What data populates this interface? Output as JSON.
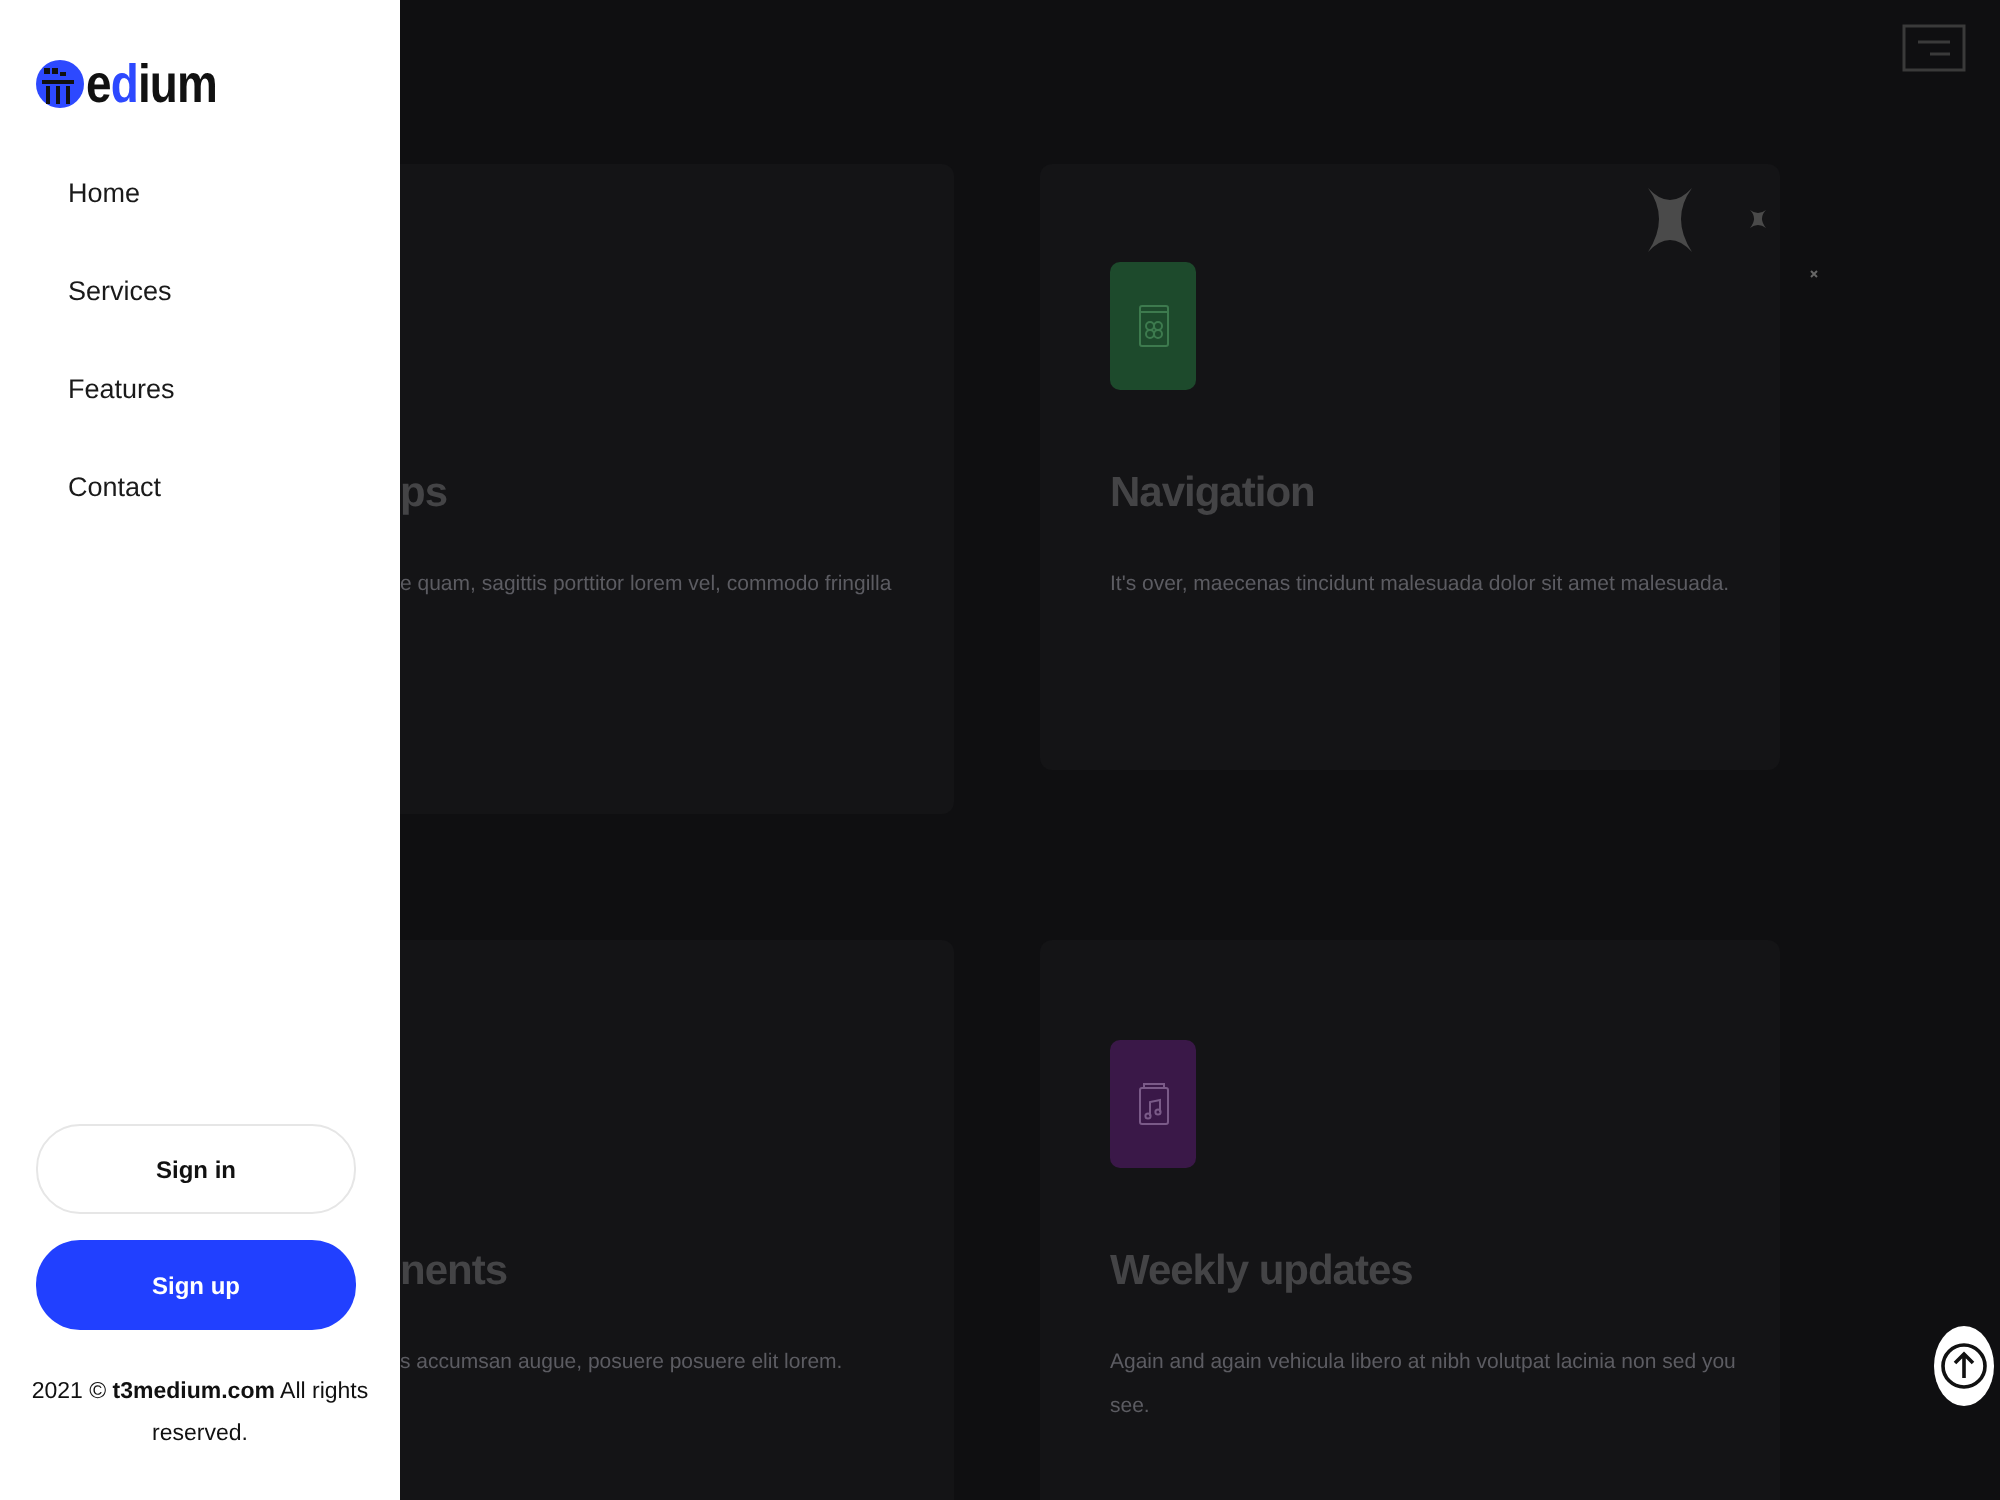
{
  "drawer": {
    "logo": {
      "parts": [
        {
          "text": "e",
          "accent": false
        },
        {
          "text": "d",
          "accent": true
        },
        {
          "text": "ium",
          "accent": false
        }
      ]
    },
    "nav": [
      {
        "label": "Home"
      },
      {
        "label": "Services"
      },
      {
        "label": "Features"
      },
      {
        "label": "Contact"
      }
    ],
    "buttons": [
      {
        "label": "Sign in",
        "kind": "outline"
      },
      {
        "label": "Sign up",
        "kind": "primary"
      }
    ],
    "footer": "2021 © **t3medium.com** All rights reserved."
  },
  "cards": [
    {
      "title": "ps",
      "text": "e quam, sagittis porttitor lorem vel, commodo fringilla"
    },
    {
      "title": "Navigation",
      "text": "It's over, maecenas tincidunt malesuada dolor sit amet malesuada.",
      "color": "#1d4a2c",
      "kind": "app"
    },
    {
      "title": "nents",
      "text": "s accumsan augue, posuere posuere elit lorem."
    },
    {
      "title": "Weekly updates",
      "text": "Again and again vehicula libero at nibh volutpat lacinia non sed you see.",
      "color": "#3a1848",
      "kind": "music"
    }
  ]
}
